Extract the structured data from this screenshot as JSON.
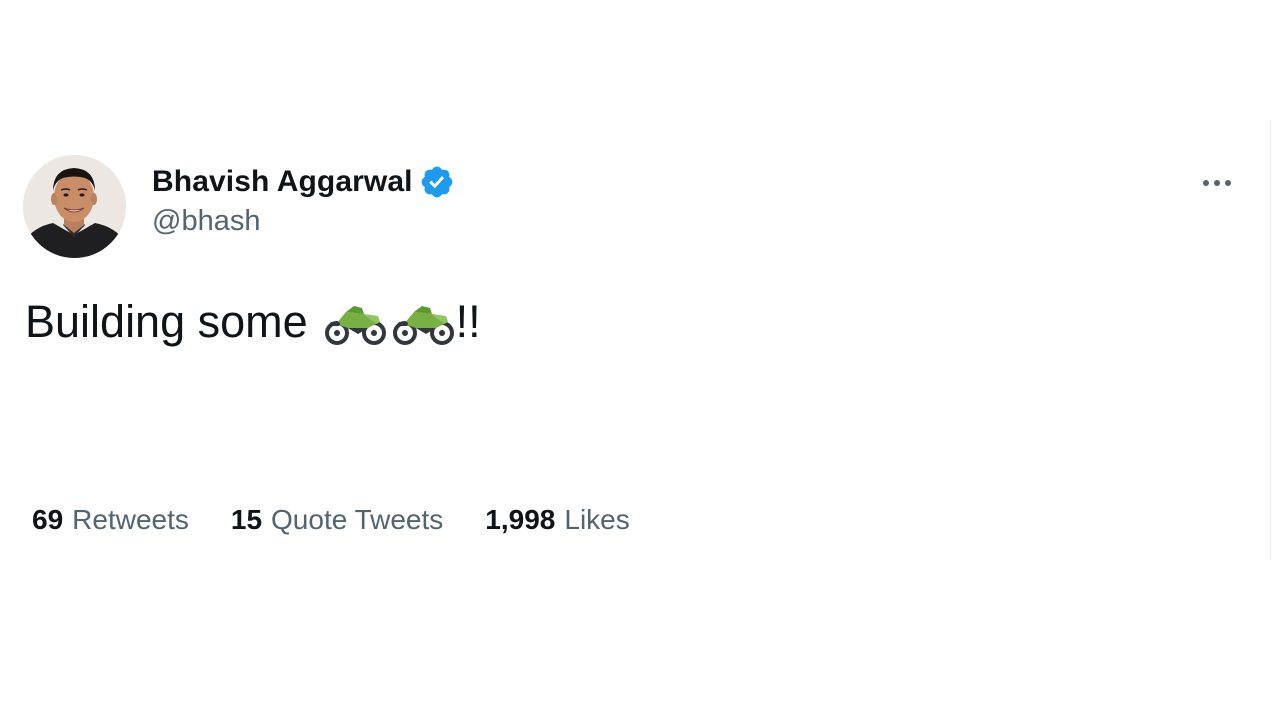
{
  "author": {
    "name": "Bhavish Aggarwal",
    "handle": "@bhash",
    "verified": true
  },
  "tweet": {
    "text": "Building some",
    "emojis": [
      "motorcycle-icon",
      "motorcycle-icon"
    ],
    "suffix": "!!"
  },
  "stats": [
    {
      "count": "69",
      "label": "Retweets"
    },
    {
      "count": "15",
      "label": "Quote Tweets"
    },
    {
      "count": "1,998",
      "label": "Likes"
    }
  ],
  "colors": {
    "verified": "#1d9bf0",
    "secondary_text": "#536471",
    "primary_text": "#0f1419",
    "emoji_green": "#78b043"
  }
}
